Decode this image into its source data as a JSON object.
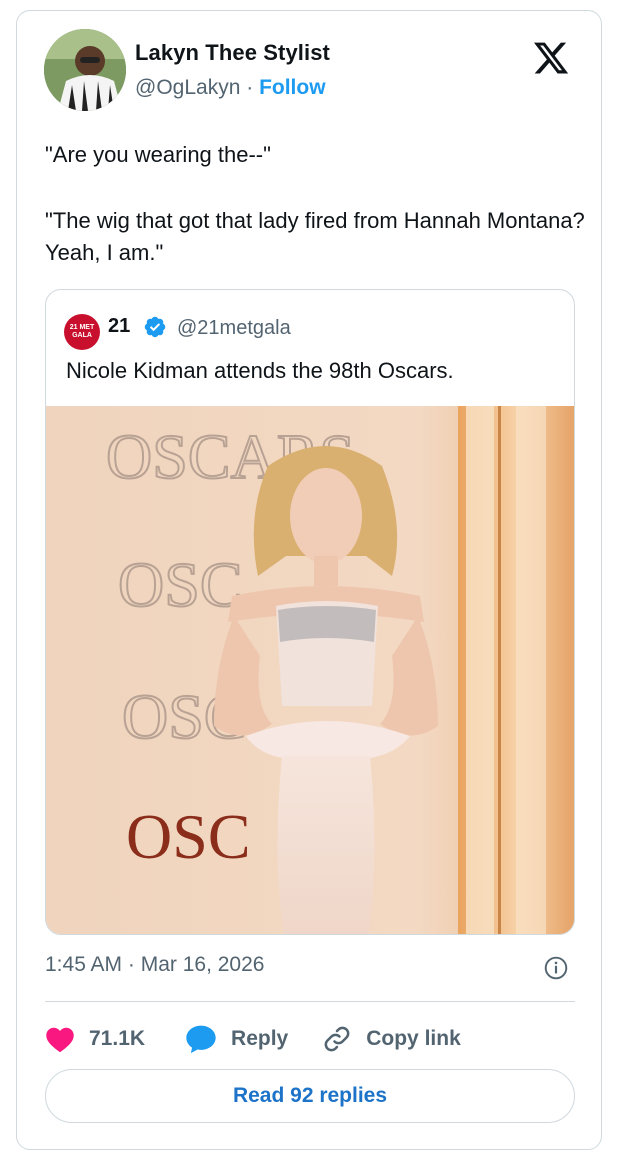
{
  "author": {
    "name": "Lakyn Thee Stylist",
    "handle": "@OgLakyn",
    "separator": "·",
    "follow_label": "Follow"
  },
  "tweet": {
    "line1": "\"Are you wearing the--\"",
    "line2": "\"The wig that got that lady fired from Hannah Montana? Yeah, I am.\""
  },
  "quote": {
    "avatar_text": "21 MET GALA",
    "name": "21",
    "handle": "@21metgala",
    "text": "Nicole Kidman attends the 98th Oscars.",
    "photo_wall_text": [
      "OSCARS",
      "OSC",
      "OSC",
      "OSC"
    ]
  },
  "meta": {
    "timestamp": "1:45 AM · Mar 16, 2026"
  },
  "actions": {
    "likes": "71.1K",
    "reply": "Reply",
    "copy_link": "Copy link"
  },
  "read_replies": "Read 92 replies",
  "colors": {
    "accent": "#1d9bf0",
    "like": "#f91880",
    "border": "#cfd9de",
    "muted": "#536471"
  }
}
